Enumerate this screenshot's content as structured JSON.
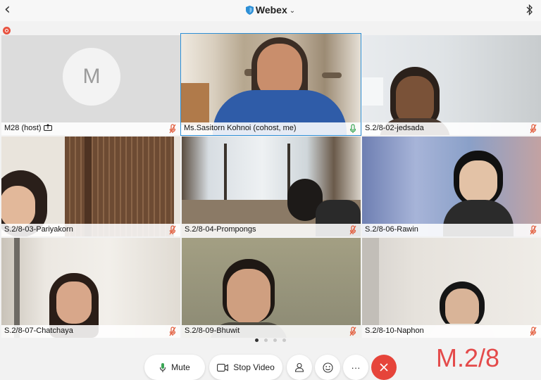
{
  "app": {
    "title": "Webex"
  },
  "colors": {
    "accent": "#2d8fd6",
    "end_call": "#e6443a",
    "recording": "#e8523f",
    "overlay_text": "#e44a4a",
    "muted_mic": "#e25b3a",
    "active_mic": "#3aa655"
  },
  "icons": {
    "back": "chevron-left-icon",
    "shield": "shield-icon",
    "title_menu": "chevron-down-icon",
    "bluetooth": "bluetooth-icon",
    "recording": "recording-icon"
  },
  "participants": [
    {
      "name": "M28 (host)",
      "avatar_letter": "M",
      "mic": "muted",
      "sharing": true
    },
    {
      "name": "Ms.Sasitorn Kohnoi (cohost, me)",
      "mic": "active",
      "active_speaker": true
    },
    {
      "name": "S.2/8-02-jedsada",
      "mic": "muted"
    },
    {
      "name": "S.2/8-03-Pariyakorn",
      "mic": "muted"
    },
    {
      "name": "S.2/8-04-Prompongs",
      "mic": "muted"
    },
    {
      "name": "S.2/8-06-Rawin",
      "mic": "muted"
    },
    {
      "name": "S.2/8-07-Chatchaya",
      "mic": "muted"
    },
    {
      "name": "S.2/8-09-Bhuwit",
      "mic": "muted"
    },
    {
      "name": "S.2/8-10-Naphon",
      "mic": "muted"
    }
  ],
  "pager": {
    "pages": 4,
    "current": 1
  },
  "controls": {
    "mute_label": "Mute",
    "stop_video_label": "Stop Video",
    "more_glyph": "···"
  },
  "overlay_text": "M.2/8"
}
